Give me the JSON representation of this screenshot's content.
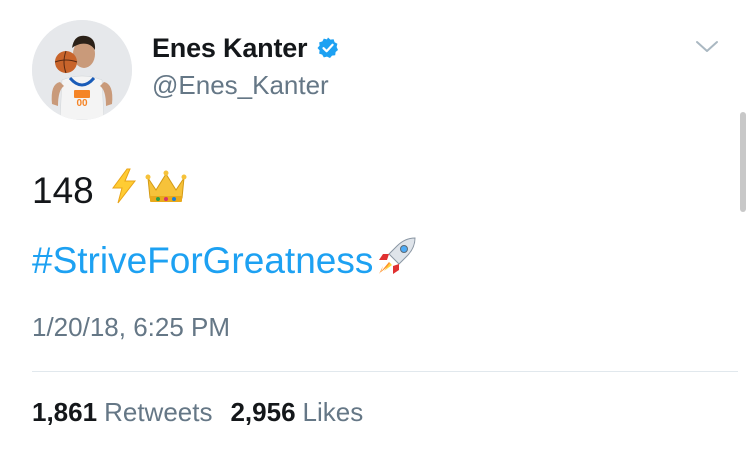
{
  "tweet": {
    "author": {
      "display_name": "Enes Kanter",
      "handle": "@Enes_Kanter",
      "verified": true
    },
    "text_line1": "148",
    "hashtag": "#StriveForGreatness",
    "emoji_icons": [
      "lightning-icon",
      "crown-icon",
      "rocket-icon"
    ],
    "timestamp": "1/20/18, 6:25 PM",
    "stats": {
      "retweets_count": "1,861",
      "retweets_label": "Retweets",
      "likes_count": "2,956",
      "likes_label": "Likes"
    }
  },
  "colors": {
    "link": "#1da1f2",
    "secondary_text": "#657786",
    "divider": "#e1e8ed",
    "verified_badge": "#1da1f2"
  }
}
